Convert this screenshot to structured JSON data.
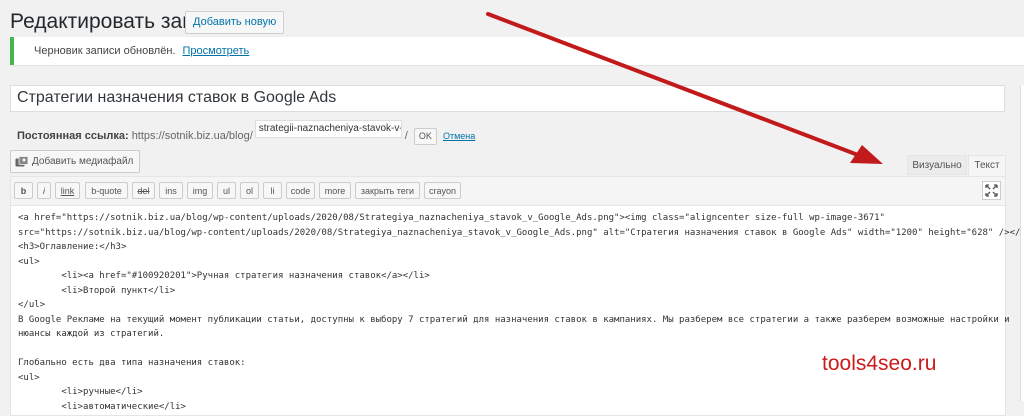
{
  "header": {
    "title": "Редактировать запись",
    "add_new": "Добавить новую"
  },
  "notice": {
    "text": "Черновик записи обновлён.",
    "link": "Просмотреть"
  },
  "post": {
    "title": "Стратегии назначения ставок в Google Ads"
  },
  "permalink": {
    "label": "Постоянная ссылка:",
    "base": "https://sotnik.biz.ua/blog/",
    "slug": "strategii-naznacheniya-stavok-v-g",
    "sep": "/",
    "ok": "OK",
    "cancel": "Отмена"
  },
  "media": {
    "button": "Добавить медиафайл"
  },
  "tabs": {
    "visual": "Визуально",
    "text": "Текст"
  },
  "toolbar": [
    "b",
    "i",
    "link",
    "b-quote",
    "del",
    "ins",
    "img",
    "ul",
    "ol",
    "li",
    "code",
    "more",
    "закрыть теги",
    "crayon"
  ],
  "code_lines": [
    "<a href=\"https://sotnik.biz.ua/blog/wp-content/uploads/2020/08/Strategiya_naznacheniya_stavok_v_Google_Ads.png\"><img class=\"aligncenter size-full wp-image-3671\"",
    "src=\"https://sotnik.biz.ua/blog/wp-content/uploads/2020/08/Strategiya_naznacheniya_stavok_v_Google_Ads.png\" alt=\"Стратегия назначения ставок в Google Ads\" width=\"1200\" height=\"628\" /></a>",
    "<h3>Оглавление:</h3>",
    "<ul>",
    "        <li><a href=\"#100920201\">Ручная стратегия назначения ставок</a></li>",
    "        <li>Второй пункт</li>",
    "</ul>",
    "В Google Рекламе на текущий момент публикации статьи, доступны к выбору 7 стратегий для назначения ставок в кампаниях. Мы разберем все стратегии а также разберем возможные настройки и",
    "нюансы каждой из стратегий.",
    "",
    "Глобально есть два типа назначения ставок:",
    "<ul>",
    "        <li>ручные</li>",
    "        <li>автоматические</li>"
  ],
  "watermark": "tools4seo.ru",
  "colors": {
    "accent": "#0073aa",
    "notice_border": "#46b450",
    "arrow": "#c21a1a",
    "watermark": "#cc1b1b"
  },
  "icons": {
    "media": "media-icon",
    "fullscreen": "fullscreen-icon"
  }
}
